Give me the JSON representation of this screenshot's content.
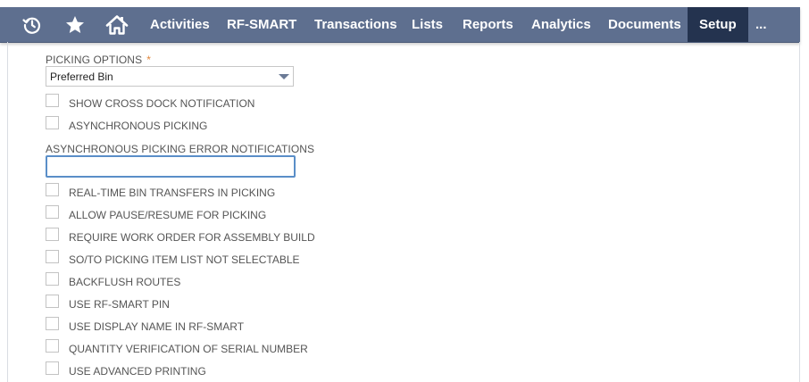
{
  "nav": {
    "icons": [
      "recent-records-icon",
      "star-icon",
      "home-icon"
    ],
    "items": [
      "Activities",
      "RF-SMART",
      "Transactions",
      "Lists",
      "Reports",
      "Analytics",
      "Documents",
      "Setup",
      "..."
    ],
    "active": "Setup",
    "colors": {
      "bar": "#5e6f8f",
      "active": "#24334f"
    }
  },
  "form": {
    "picking_options_label": "PICKING OPTIONS",
    "required_mark": "*",
    "picking_options_value": "Preferred Bin",
    "async_error_label": "ASYNCHRONOUS PICKING ERROR NOTIFICATIONS",
    "async_error_value": "",
    "checkboxes": [
      {
        "label": "SHOW CROSS DOCK NOTIFICATION",
        "checked": false
      },
      {
        "label": "ASYNCHRONOUS PICKING",
        "checked": false
      },
      {
        "label": "REAL-TIME BIN TRANSFERS IN PICKING",
        "checked": false
      },
      {
        "label": "ALLOW PAUSE/RESUME FOR PICKING",
        "checked": false
      },
      {
        "label": "REQUIRE WORK ORDER FOR ASSEMBLY BUILD",
        "checked": false
      },
      {
        "label": "SO/TO PICKING ITEM LIST NOT SELECTABLE",
        "checked": false
      },
      {
        "label": "BACKFLUSH ROUTES",
        "checked": false
      },
      {
        "label": "USE RF-SMART PIN",
        "checked": false
      },
      {
        "label": "USE DISPLAY NAME IN RF-SMART",
        "checked": false
      },
      {
        "label": "QUANTITY VERIFICATION OF SERIAL NUMBER",
        "checked": false
      },
      {
        "label": "USE ADVANCED PRINTING",
        "checked": false
      }
    ]
  }
}
